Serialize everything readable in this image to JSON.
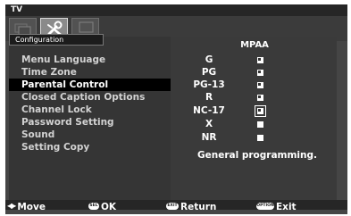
{
  "window": {
    "title": "TV"
  },
  "tabs": [
    {
      "icon": "picture-icon",
      "label": ""
    },
    {
      "icon": "setup-wrench-icon",
      "label": "SETUP"
    },
    {
      "icon": "monitor-icon",
      "label": ""
    }
  ],
  "menu": {
    "header": "Configuration",
    "items": [
      "Menu Language",
      "Time Zone",
      "Parental Control",
      "Closed Caption Options",
      "Channel Lock",
      "Password Setting",
      "Sound",
      "Setting Copy"
    ],
    "selected": "Parental Control"
  },
  "ratings": {
    "title": "MPAA",
    "items": [
      {
        "label": "G",
        "locked": true
      },
      {
        "label": "PG",
        "locked": true
      },
      {
        "label": "PG-13",
        "locked": true
      },
      {
        "label": "R",
        "locked": true
      },
      {
        "label": "NC-17",
        "locked": true,
        "focused": true
      },
      {
        "label": "X",
        "locked": false
      },
      {
        "label": "NR",
        "locked": false
      }
    ],
    "description": "General programming."
  },
  "footer": {
    "move": {
      "key": "arrows",
      "label": "Move"
    },
    "ok": {
      "key": "SEL",
      "label": "OK"
    },
    "return": {
      "key": "EXIT",
      "label": "Return"
    },
    "exit": {
      "key": "OPTION",
      "label": "Exit"
    }
  }
}
